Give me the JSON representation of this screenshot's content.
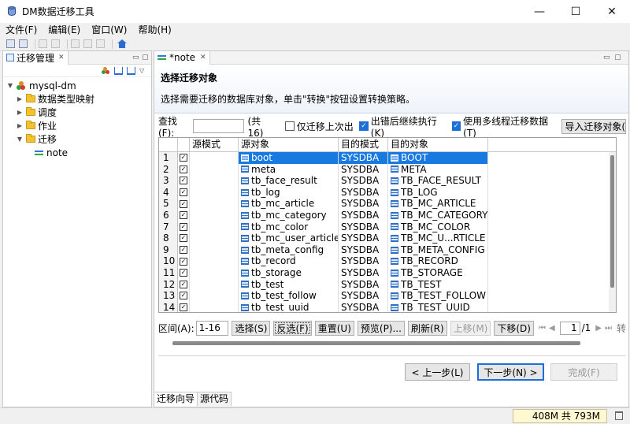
{
  "window": {
    "title": "DM数据迁移工具",
    "minimize": "—",
    "maximize": "☐",
    "close": "✕"
  },
  "menu": [
    "文件(F)",
    "编辑(E)",
    "窗口(W)",
    "帮助(H)"
  ],
  "left_panel": {
    "tab_label": "迁移管理",
    "tree": {
      "root": "mysql-dm",
      "items": [
        "数据类型映射",
        "调度",
        "作业",
        "迁移"
      ],
      "child": "note"
    }
  },
  "editor": {
    "tab_label": "*note",
    "wizard_title": "选择迁移对象",
    "wizard_desc": "选择需要迁移的数据库对象，单击\"转换\"按钮设置转换策略。",
    "find_label": "查找(F):",
    "find_value": "",
    "count_text": "(共 16)",
    "only_last_fail": "仅迁移上次出",
    "continue_on_error": "出错后继续执行(K)",
    "multi_thread": "使用多线程迁移数据(T)",
    "import_btn": "导入迁移对象(I)"
  },
  "table": {
    "headers": [
      "",
      "",
      "源模式",
      "源对象",
      "目的模式",
      "目的对象"
    ],
    "rows": [
      {
        "n": "1",
        "src": "boot",
        "dst_schema": "SYSDBA",
        "dst": "BOOT"
      },
      {
        "n": "2",
        "src": "meta",
        "dst_schema": "SYSDBA",
        "dst": "META"
      },
      {
        "n": "3",
        "src": "tb_face_result",
        "dst_schema": "SYSDBA",
        "dst": "TB_FACE_RESULT"
      },
      {
        "n": "4",
        "src": "tb_log",
        "dst_schema": "SYSDBA",
        "dst": "TB_LOG"
      },
      {
        "n": "5",
        "src": "tb_mc_article",
        "dst_schema": "SYSDBA",
        "dst": "TB_MC_ARTICLE"
      },
      {
        "n": "6",
        "src": "tb_mc_category",
        "dst_schema": "SYSDBA",
        "dst": "TB_MC_CATEGORY"
      },
      {
        "n": "7",
        "src": "tb_mc_color",
        "dst_schema": "SYSDBA",
        "dst": "TB_MC_COLOR"
      },
      {
        "n": "8",
        "src": "tb_mc_user_article",
        "dst_schema": "SYSDBA",
        "dst": "TB_MC_U...RTICLE"
      },
      {
        "n": "9",
        "src": "tb_meta_config",
        "dst_schema": "SYSDBA",
        "dst": "TB_META_CONFIG"
      },
      {
        "n": "10",
        "src": "tb_record",
        "dst_schema": "SYSDBA",
        "dst": "TB_RECORD"
      },
      {
        "n": "11",
        "src": "tb_storage",
        "dst_schema": "SYSDBA",
        "dst": "TB_STORAGE"
      },
      {
        "n": "12",
        "src": "tb_test",
        "dst_schema": "SYSDBA",
        "dst": "TB_TEST"
      },
      {
        "n": "13",
        "src": "tb_test_follow",
        "dst_schema": "SYSDBA",
        "dst": "TB_TEST_FOLLOW"
      },
      {
        "n": "14",
        "src": "tb_test_uuid",
        "dst_schema": "SYSDBA",
        "dst": "TB_TEST_UUID"
      }
    ]
  },
  "range": {
    "label": "区间(A):",
    "value": "1-16",
    "select": "选择(S)",
    "invert": "反选(F)",
    "reset": "重置(U)",
    "preview": "预览(P)...",
    "refresh": "刷新(R)",
    "move_up": "上移(M)",
    "move_down": "下移(D)",
    "nav_first": "⏮",
    "nav_prev": "◀",
    "page": "1",
    "page_total": "/1",
    "nav_next": "▶",
    "nav_last": "⏭",
    "convert": "转"
  },
  "wizard_buttons": {
    "prev": "< 上一步(L)",
    "next": "下一步(N) >",
    "finish": "完成(F)"
  },
  "bottom_tabs": [
    "迁移向导",
    "源代码"
  ],
  "status": {
    "memory": "408M 共 793M"
  },
  "colors": {
    "selection": "#1879e0",
    "folder": "#f2c230",
    "accent": "#1d6fd8"
  }
}
